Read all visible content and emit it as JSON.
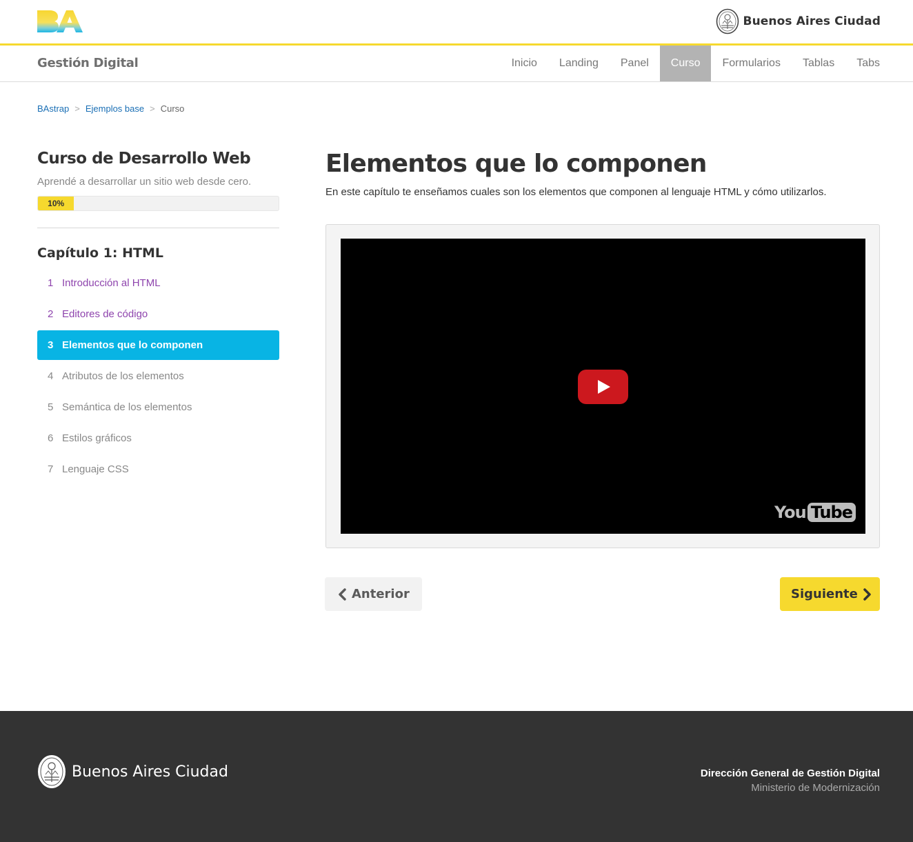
{
  "colors": {
    "accent_yellow": "#f6d92e",
    "active_blue": "#08b4e4",
    "visited_purple": "#8e44ad",
    "link_blue": "#1a6fb5",
    "footer_bg": "#333333",
    "youtube_red": "#cc181e"
  },
  "header": {
    "logo_icon": "ba-logo",
    "city_name": "Buenos Aires Ciudad",
    "city_icon": "city-seal-icon"
  },
  "navbar": {
    "brand": "Gestión Digital",
    "items": [
      {
        "label": "Inicio",
        "active": false
      },
      {
        "label": "Landing",
        "active": false
      },
      {
        "label": "Panel",
        "active": false
      },
      {
        "label": "Curso",
        "active": true
      },
      {
        "label": "Formularios",
        "active": false
      },
      {
        "label": "Tablas",
        "active": false
      },
      {
        "label": "Tabs",
        "active": false
      }
    ]
  },
  "breadcrumb": {
    "items": [
      {
        "label": "BAstrap",
        "link": true
      },
      {
        "label": "Ejemplos base",
        "link": true
      },
      {
        "label": "Curso",
        "link": false
      }
    ],
    "separator": ">"
  },
  "sidebar": {
    "course_title": "Curso de Desarrollo Web",
    "course_subtitle": "Aprendé a desarrollar un sitio web desde cero.",
    "progress_label": "10%",
    "progress_value": 0.15,
    "chapter_title": "Capítulo 1: HTML",
    "lessons": [
      {
        "num": "1",
        "label": "Introducción al HTML",
        "state": "visited"
      },
      {
        "num": "2",
        "label": "Editores de código",
        "state": "visited"
      },
      {
        "num": "3",
        "label": "Elementos que lo componen",
        "state": "active"
      },
      {
        "num": "4",
        "label": "Atributos de los elementos",
        "state": "default"
      },
      {
        "num": "5",
        "label": "Semántica de los elementos",
        "state": "default"
      },
      {
        "num": "6",
        "label": "Estilos gráficos",
        "state": "default"
      },
      {
        "num": "7",
        "label": "Lenguaje CSS",
        "state": "default"
      }
    ]
  },
  "main": {
    "title": "Elementos que lo componen",
    "description": "En este capítulo te enseñamos cuales son los elementos que componen al lenguaje HTML y cómo utilizarlos.",
    "video": {
      "play_icon": "play-icon",
      "brand_you": "You",
      "brand_tube": "Tube"
    },
    "prev_label": "Anterior",
    "next_label": "Siguiente"
  },
  "footer": {
    "brand": "Buenos Aires Ciudad",
    "line1": "Dirección General de Gestión Digital",
    "line2": "Ministerio de Modernización"
  }
}
